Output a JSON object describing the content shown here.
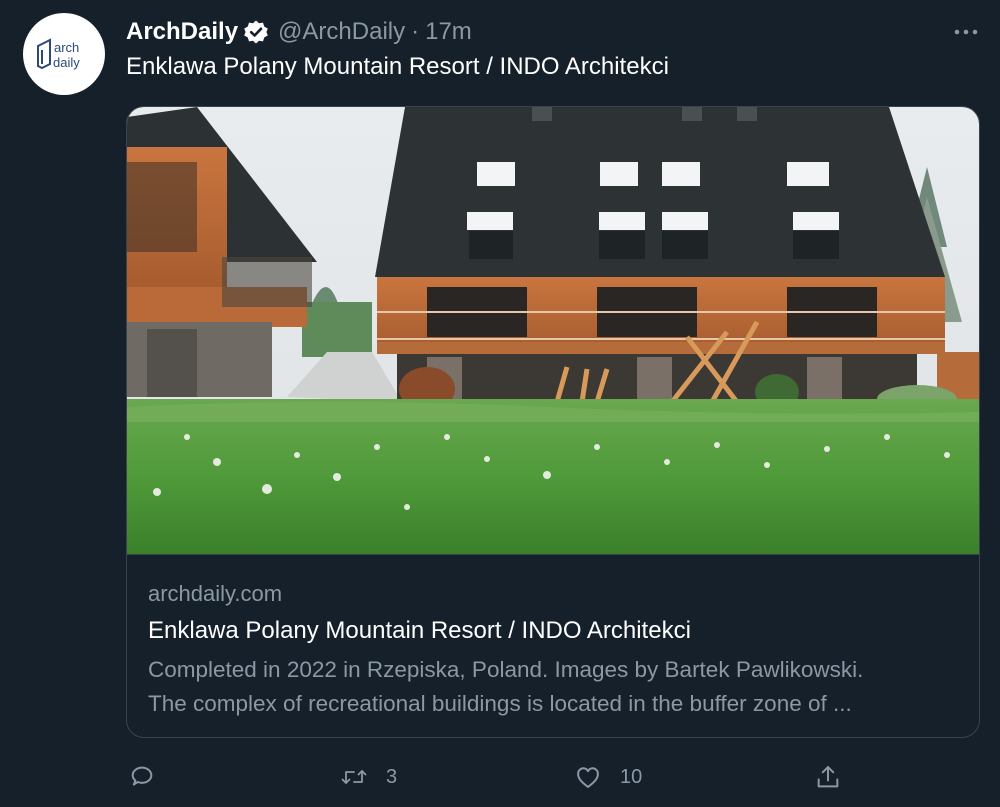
{
  "author": {
    "display_name": "ArchDaily",
    "handle": "@ArchDaily",
    "separator": "·",
    "timestamp": "17m",
    "verified": true,
    "avatar_text_line1": "arch",
    "avatar_text_line2": "daily"
  },
  "tweet": {
    "text": "Enklawa Polany Mountain Resort / INDO Architekci"
  },
  "link_card": {
    "domain": "archdaily.com",
    "title": "Enklawa Polany Mountain Resort / INDO Architekci",
    "description_line1": "Completed in 2022 in Rzepiska, Poland. Images by Bartek Pawlikowski.",
    "description_line2": "The complex of recreational buildings is located in the buffer zone of ..."
  },
  "actions": {
    "reply_count": "",
    "retweet_count": "3",
    "like_count": "10"
  },
  "icons": {
    "more": "more-horizontal-icon",
    "verified": "verified-badge-icon",
    "reply": "reply-icon",
    "retweet": "retweet-icon",
    "like": "heart-icon",
    "share": "share-icon"
  },
  "colors": {
    "background": "#15202b",
    "text_primary": "#ffffff",
    "text_secondary": "#8b98a5",
    "border": "#38444d"
  }
}
